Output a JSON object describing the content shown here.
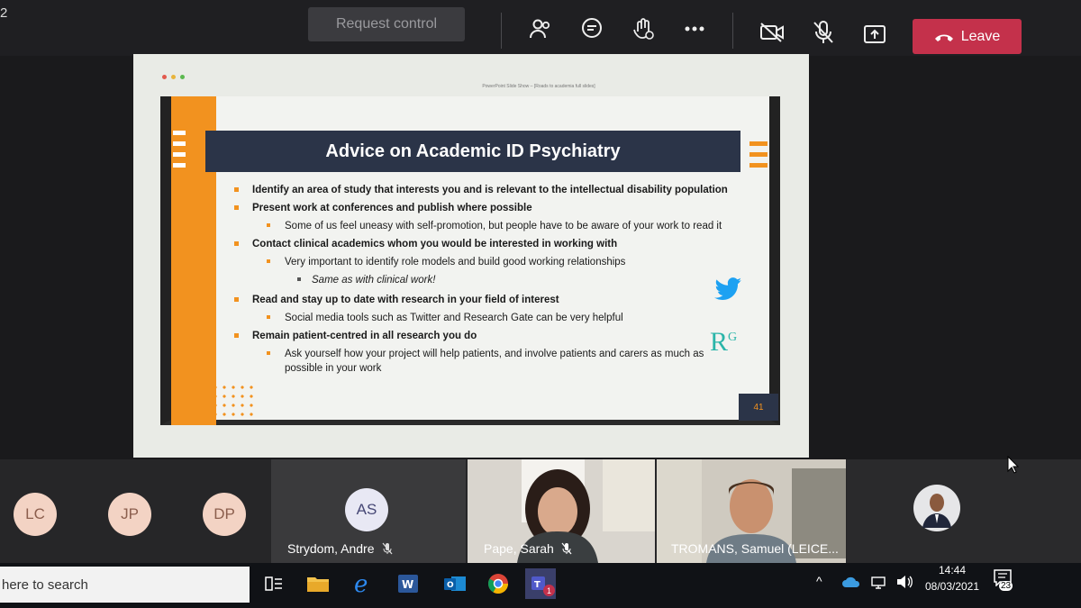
{
  "top_bar": {
    "corner_text": "2",
    "request_control_label": "Request control",
    "icons": [
      "people-icon",
      "chat-icon",
      "raise-hand-icon",
      "more-icon",
      "camera-off-icon",
      "mic-off-icon",
      "share-icon"
    ],
    "leave_label": "Leave",
    "leave_color": "#c4314b"
  },
  "slide": {
    "window_caption": "PowerPoint Slide Show – [Roads to academia full slides]",
    "title": "Advice on Academic ID Psychiatry",
    "bullets": [
      {
        "text": "Identify an area of study that interests you and is relevant to the intellectual disability population"
      },
      {
        "text": "Present work at conferences and publish where possible"
      },
      {
        "sub": "Some of us feel uneasy with self-promotion, but people have to be aware of your work to read it"
      },
      {
        "text": "Contact clinical academics whom you would be interested in working with"
      },
      {
        "sub": "Very important to identify role models and build good working relationships"
      },
      {
        "subsub": "Same as with clinical work!"
      },
      {
        "text": "Read and stay up to date with research in your field of interest"
      },
      {
        "sub": "Social media tools such as Twitter and Research Gate can be very helpful"
      },
      {
        "text": "Remain patient-centred in all research you do"
      },
      {
        "sub": "Ask yourself how your project will help patients, and involve patients and carers as much as possible in your work"
      }
    ],
    "logo_rg": "R",
    "logo_rg_sup": "G",
    "slide_number": "41",
    "accent_color": "#f2921f",
    "title_bg": "#2b3448"
  },
  "participants": {
    "avatars": [
      {
        "initials": "LC"
      },
      {
        "initials": "JP"
      },
      {
        "initials": "DP"
      }
    ],
    "as_initials": "AS",
    "strydom_name": "Strydom, Andre",
    "sarah_name": "Pape, Sarah",
    "samuel_name": "TROMANS, Samuel (LEICE..."
  },
  "taskbar": {
    "search_placeholder": "here to search",
    "apps": [
      "task-view-icon",
      "file-explorer-icon",
      "edge-icon",
      "word-icon",
      "outlook-icon",
      "chrome-icon",
      "teams-icon"
    ],
    "time": "14:44",
    "date": "08/03/2021",
    "notification_count": "23",
    "teams_badge": "1"
  }
}
